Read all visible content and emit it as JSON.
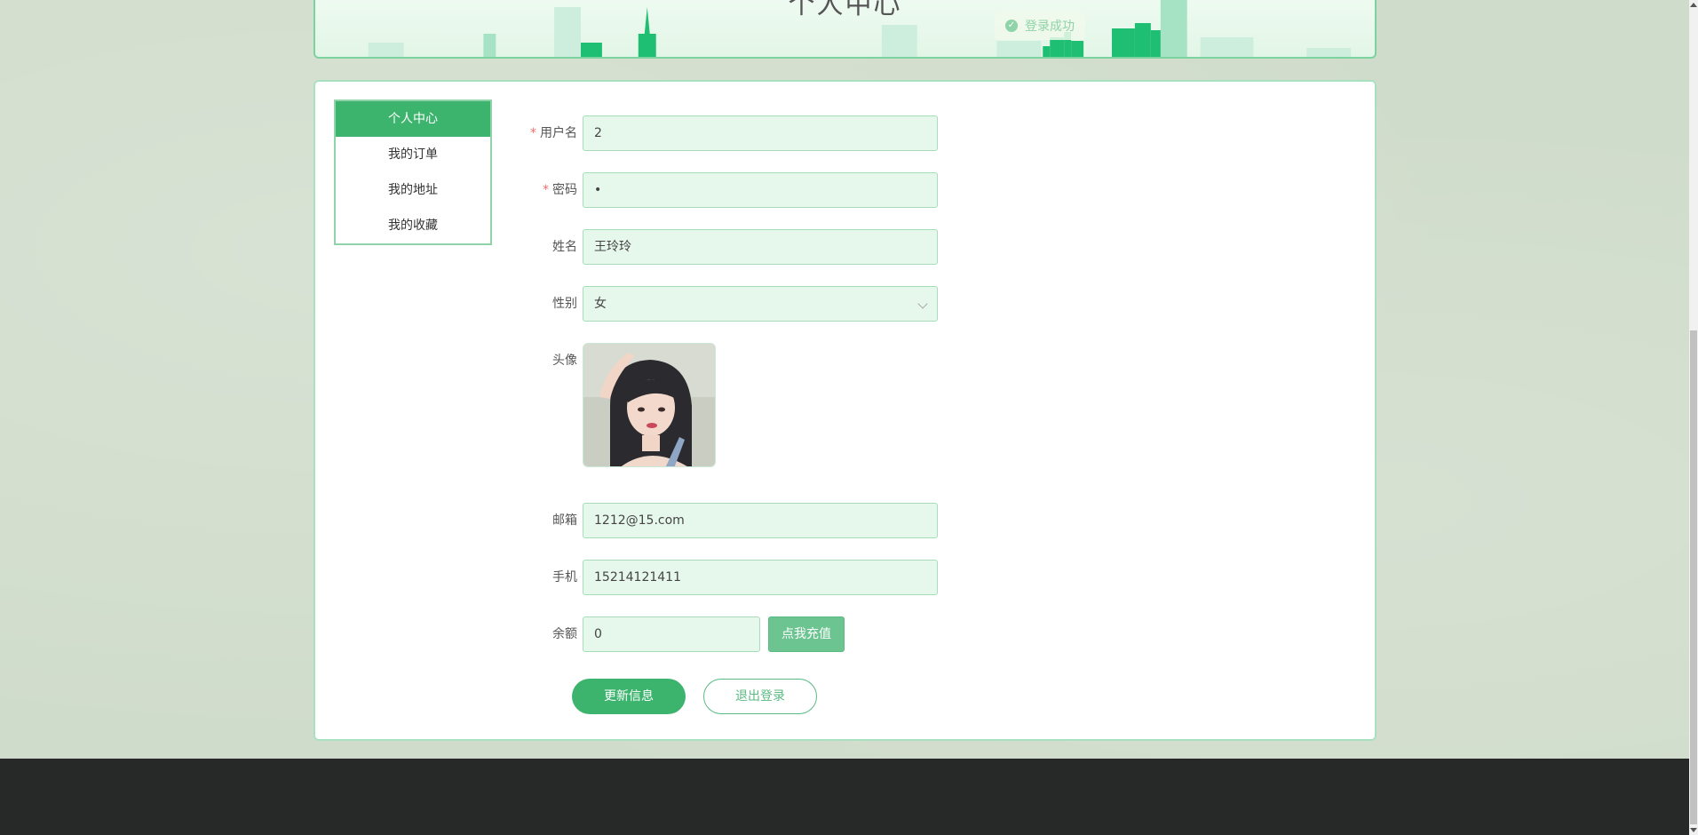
{
  "banner": {
    "title": "个人中心",
    "toast": "登录成功"
  },
  "side_menu": {
    "items": [
      {
        "label": "个人中心",
        "active": true
      },
      {
        "label": "我的订单",
        "active": false
      },
      {
        "label": "我的地址",
        "active": false
      },
      {
        "label": "我的收藏",
        "active": false
      }
    ]
  },
  "form": {
    "username": {
      "label": "用户名",
      "value": "2",
      "required": true
    },
    "password": {
      "label": "密码",
      "value": "•",
      "required": true
    },
    "name": {
      "label": "姓名",
      "value": "王玲玲"
    },
    "gender": {
      "label": "性别",
      "value": "女"
    },
    "avatar": {
      "label": "头像"
    },
    "email": {
      "label": "邮箱",
      "value": "1212@15.com"
    },
    "phone": {
      "label": "手机",
      "value": "15214121411"
    },
    "balance": {
      "label": "余额",
      "value": "0",
      "recharge_label": "点我充值"
    }
  },
  "actions": {
    "update_label": "更新信息",
    "logout_label": "退出登录"
  },
  "colors": {
    "accent": "#3cb46e",
    "input_bg": "#e6f7ec",
    "footer": "#262928",
    "page_bg": "#d0dccb"
  }
}
